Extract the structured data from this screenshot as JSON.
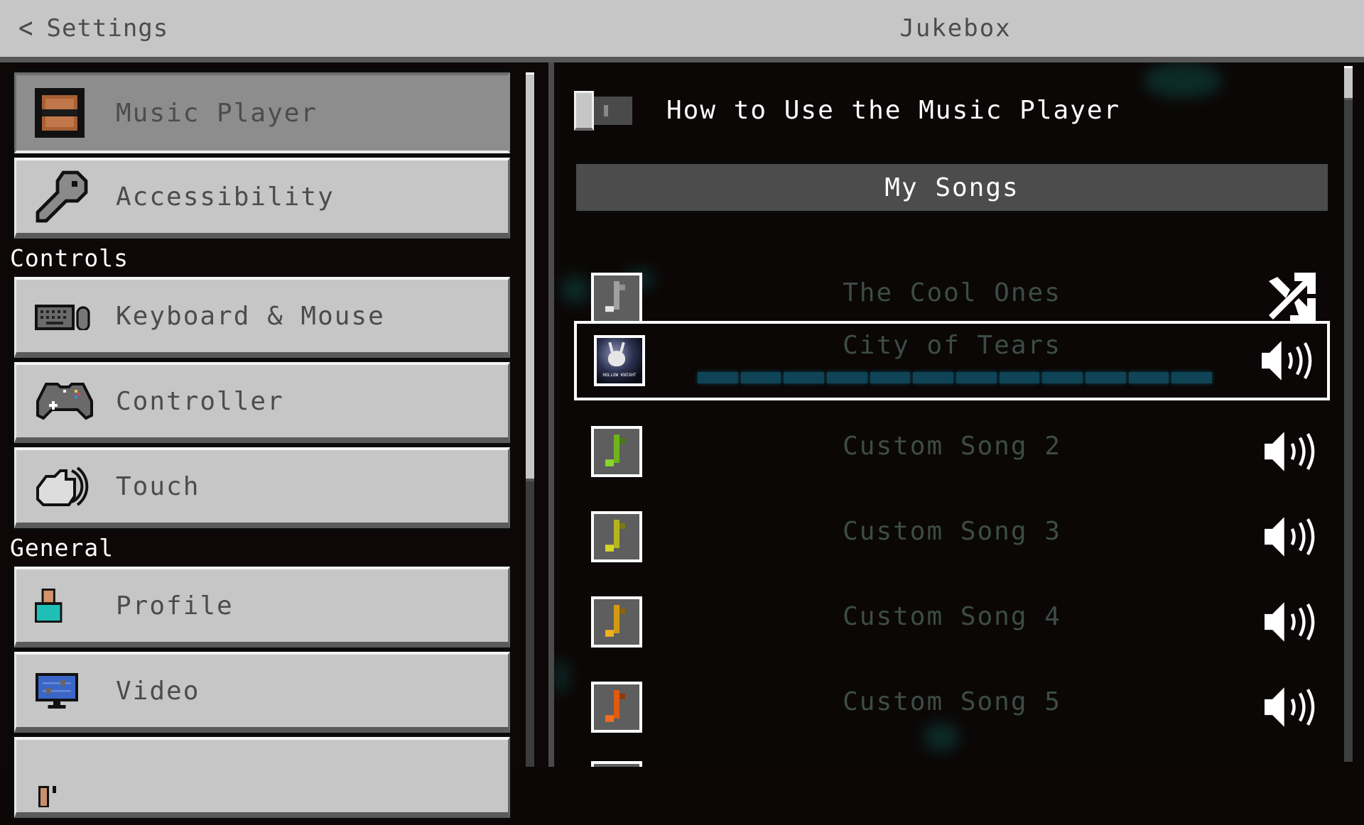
{
  "header": {
    "back_label": "Settings",
    "title": "Jukebox"
  },
  "sidebar": {
    "items_top": [
      {
        "label": "Music Player",
        "icon": "jukebox-icon",
        "selected": true
      },
      {
        "label": "Accessibility",
        "icon": "key-icon",
        "selected": false
      }
    ],
    "sections": [
      {
        "title": "Controls",
        "items": [
          {
            "label": "Keyboard & Mouse",
            "icon": "keyboard-mouse-icon"
          },
          {
            "label": "Controller",
            "icon": "gamepad-icon"
          },
          {
            "label": "Touch",
            "icon": "touch-hand-icon"
          }
        ]
      },
      {
        "title": "General",
        "items": [
          {
            "label": "Profile",
            "icon": "profile-icon"
          },
          {
            "label": "Video",
            "icon": "monitor-sliders-icon"
          },
          {
            "label": "",
            "icon": "partially-visible-icon"
          }
        ]
      }
    ]
  },
  "main": {
    "help_toggle": {
      "label": "How to Use the Music Player",
      "on": false
    },
    "list_header": "My Songs",
    "songs": [
      {
        "name": "The Cool Ones",
        "art": "music-note-gray",
        "art_color": "#b0b0b0",
        "action": "shuffle-icon"
      },
      {
        "name": "City of Tears",
        "art": "album-art",
        "art_caption": "HOLLOW KNIGHT",
        "action": "speaker-icon",
        "playing": true,
        "progress_segments": 12,
        "progress_color": "#0f4456"
      },
      {
        "name": "Custom Song 2",
        "art": "music-note-green",
        "art_color": "#6fb41e",
        "action": "speaker-icon"
      },
      {
        "name": "Custom Song 3",
        "art": "music-note-olive",
        "art_color": "#b4b41e",
        "action": "speaker-icon"
      },
      {
        "name": "Custom Song 4",
        "art": "music-note-amber",
        "art_color": "#d49a14",
        "action": "speaker-icon"
      },
      {
        "name": "Custom Song 5",
        "art": "music-note-orange",
        "art_color": "#e05a12",
        "action": "speaker-icon"
      }
    ]
  },
  "colors": {
    "header_bg": "#c6c6c6",
    "button_bg": "#c6c6c6",
    "button_selected_bg": "#8d8d8d",
    "song_text": "#3d4c46",
    "panel_bg": "#0b0706"
  }
}
